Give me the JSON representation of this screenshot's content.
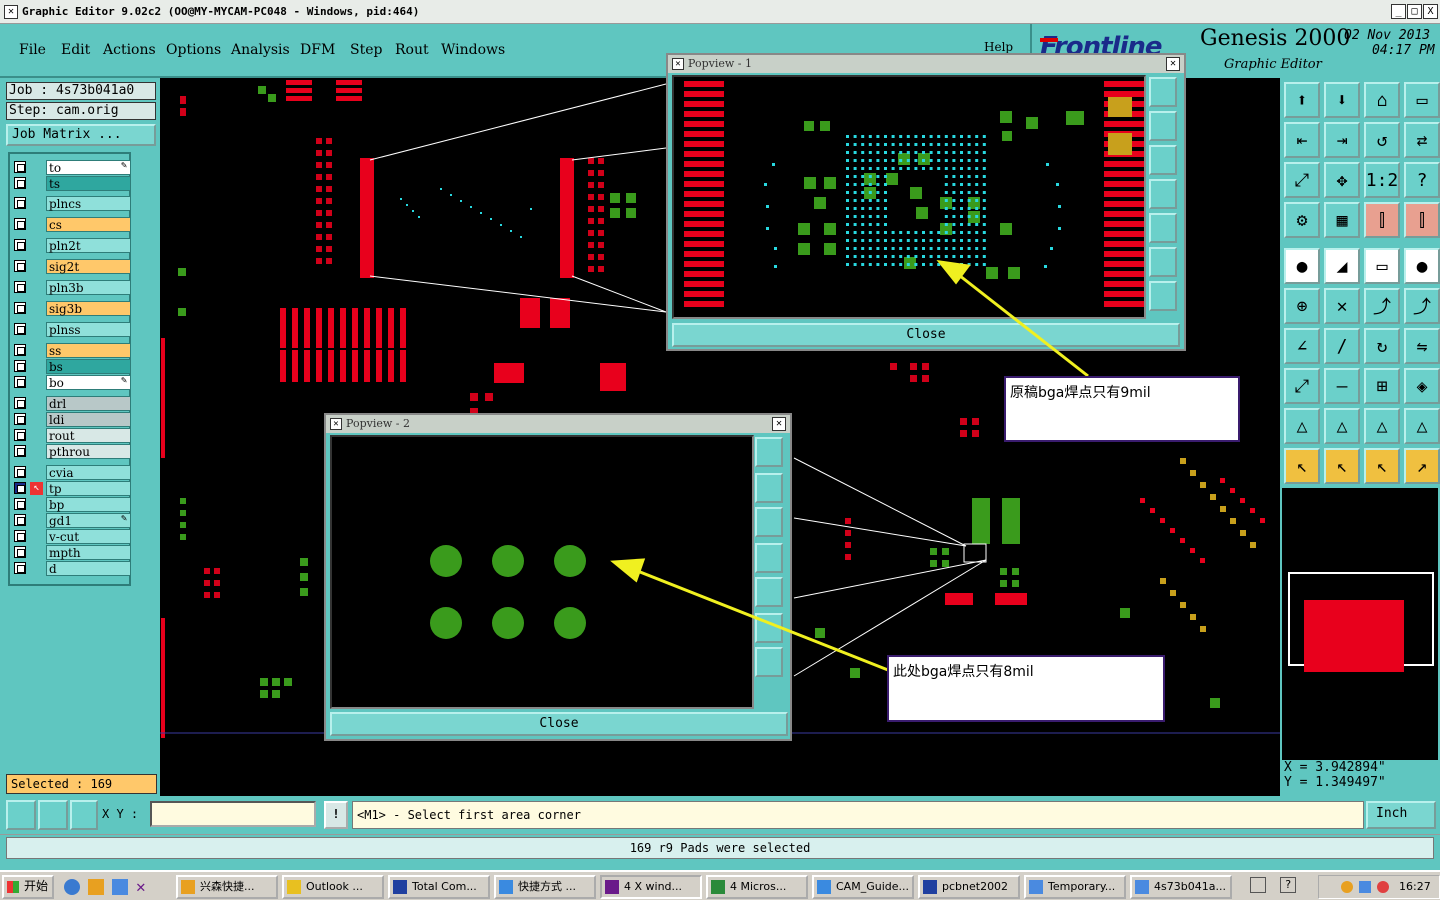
{
  "window": {
    "title": "Graphic Editor 9.02c2  (OO@MY-MYCAM-PC048 - Windows, pid:464)",
    "buttons": [
      "_",
      "□",
      "X"
    ]
  },
  "menu": {
    "items": [
      "File",
      "Edit",
      "Actions",
      "Options",
      "Analysis",
      "DFM",
      "Step",
      "Rout",
      "Windows"
    ],
    "help": "Help"
  },
  "brand": {
    "logo": "Frontline",
    "product": "Genesis 2000",
    "date": "02 Nov 2013",
    "time": "04:17 PM",
    "subtitle": "Graphic Editor"
  },
  "job": {
    "job_label": "Job : 4s73b041a0",
    "step_label": "Step: cam.orig",
    "matrix_button": "Job Matrix ..."
  },
  "layers": [
    {
      "name": "to",
      "color": "#ffffff",
      "edit": true
    },
    {
      "name": "ts",
      "color": "#2fa79f"
    },
    {
      "name": "plncs",
      "color": "#8fe0da"
    },
    {
      "name": "cs",
      "color": "#ffc86a"
    },
    {
      "name": "pln2t",
      "color": "#8fe0da"
    },
    {
      "name": "sig2t",
      "color": "#ffc86a"
    },
    {
      "name": "pln3b",
      "color": "#8fe0da"
    },
    {
      "name": "sig3b",
      "color": "#ffc86a"
    },
    {
      "name": "plnss",
      "color": "#8fe0da"
    },
    {
      "name": "ss",
      "color": "#ffc86a"
    },
    {
      "name": "bs",
      "color": "#2fa79f"
    },
    {
      "name": "bo",
      "color": "#ffffff",
      "edit": true
    },
    {
      "name": "drl",
      "color": "#b8c8c8"
    },
    {
      "name": "ldi",
      "color": "#b8c8c8"
    },
    {
      "name": "rout",
      "color": "#d8e8e6"
    },
    {
      "name": "pthrou",
      "color": "#d8e8e6"
    },
    {
      "name": "cvia",
      "color": "#8fe0da"
    },
    {
      "name": "tp",
      "color": "#8fe0da",
      "active": true
    },
    {
      "name": "bp",
      "color": "#8fe0da"
    },
    {
      "name": "gd1",
      "color": "#8fe0da",
      "edit": true
    },
    {
      "name": "v-cut",
      "color": "#8fe0da"
    },
    {
      "name": "mpth",
      "color": "#8fe0da"
    },
    {
      "name": "d",
      "color": "#8fe0da"
    }
  ],
  "selected": "Selected : 169",
  "popview1": {
    "title": "Popview - 1",
    "close": "Close"
  },
  "popview2": {
    "title": "Popview - 2",
    "close": "Close"
  },
  "annotations": {
    "note1": "原稿bga焊点只有9mil",
    "note2": "此处bga焊点只有8mil"
  },
  "coords": {
    "x": "X  =  3.942894\"",
    "y": "Y  =  1.349497\""
  },
  "cmd": {
    "xy_label": "X Y :",
    "xy_value": "",
    "prompt": "<M1> - Select first area corner",
    "units": "Inch"
  },
  "status": "169 r9 Pads were selected",
  "taskbar": {
    "start": "开始",
    "tasks": [
      "兴森快捷...",
      "Outlook ...",
      "Total Com...",
      "快捷方式 ...",
      "4 X wind...",
      "4 Micros...",
      "CAM_Guide...",
      "pcbnet2002",
      "Temporary...",
      "4s73b041a..."
    ],
    "clock": "16:27"
  }
}
